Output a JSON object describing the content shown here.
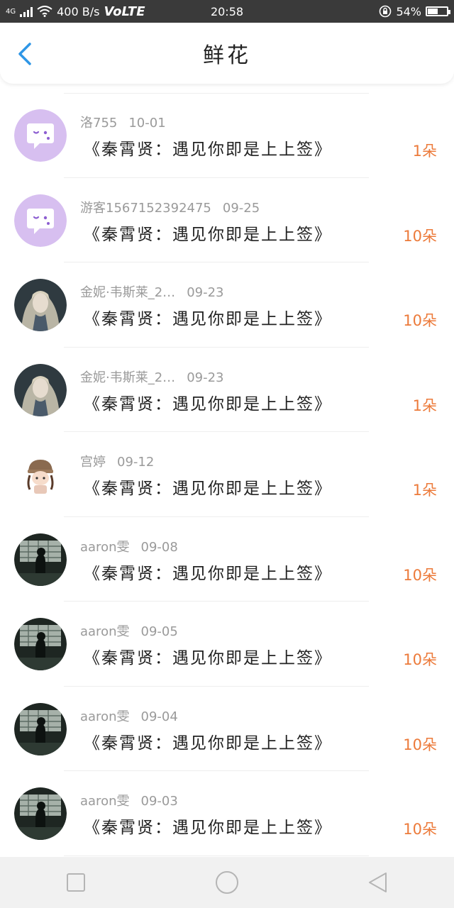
{
  "status_bar": {
    "network_type": "4G",
    "speed": "400 B/s",
    "volte": "VoLTE",
    "time": "20:58",
    "battery": "54%",
    "battery_level": 0.54
  },
  "header": {
    "title": "鲜花"
  },
  "gifts": [
    {
      "user": "洛755",
      "date": "10-01",
      "message": "《秦霄贤：遇见你即是上上签》",
      "amount": "1朵",
      "avatar": "chat-bubble-icon"
    },
    {
      "user": "游客1567152392475",
      "date": "09-25",
      "message": "《秦霄贤：遇见你即是上上签》",
      "amount": "10朵",
      "avatar": "chat-bubble-icon"
    },
    {
      "user": "金妮·韦斯莱_2…",
      "date": "09-23",
      "message": "《秦霄贤：遇见你即是上上签》",
      "amount": "10朵",
      "avatar": "girl-portrait"
    },
    {
      "user": "金妮·韦斯莱_2…",
      "date": "09-23",
      "message": "《秦霄贤：遇见你即是上上签》",
      "amount": "1朵",
      "avatar": "girl-portrait"
    },
    {
      "user": "宫婷",
      "date": "09-12",
      "message": "《秦霄贤：遇见你即是上上签》",
      "amount": "1朵",
      "avatar": "cartoon-girl"
    },
    {
      "user": "aaron雯",
      "date": "09-08",
      "message": "《秦霄贤：遇见你即是上上签》",
      "amount": "10朵",
      "avatar": "dark-silhouette"
    },
    {
      "user": "aaron雯",
      "date": "09-05",
      "message": "《秦霄贤：遇见你即是上上签》",
      "amount": "10朵",
      "avatar": "dark-silhouette"
    },
    {
      "user": "aaron雯",
      "date": "09-04",
      "message": "《秦霄贤：遇见你即是上上签》",
      "amount": "10朵",
      "avatar": "dark-silhouette"
    },
    {
      "user": "aaron雯",
      "date": "09-03",
      "message": "《秦霄贤：遇见你即是上上签》",
      "amount": "10朵",
      "avatar": "dark-silhouette"
    }
  ],
  "colors": {
    "accent": "#2e96e6",
    "amount": "#ec7a3a",
    "status_bar": "#3a3a3a",
    "avatar_purple": "#d7bff0"
  }
}
